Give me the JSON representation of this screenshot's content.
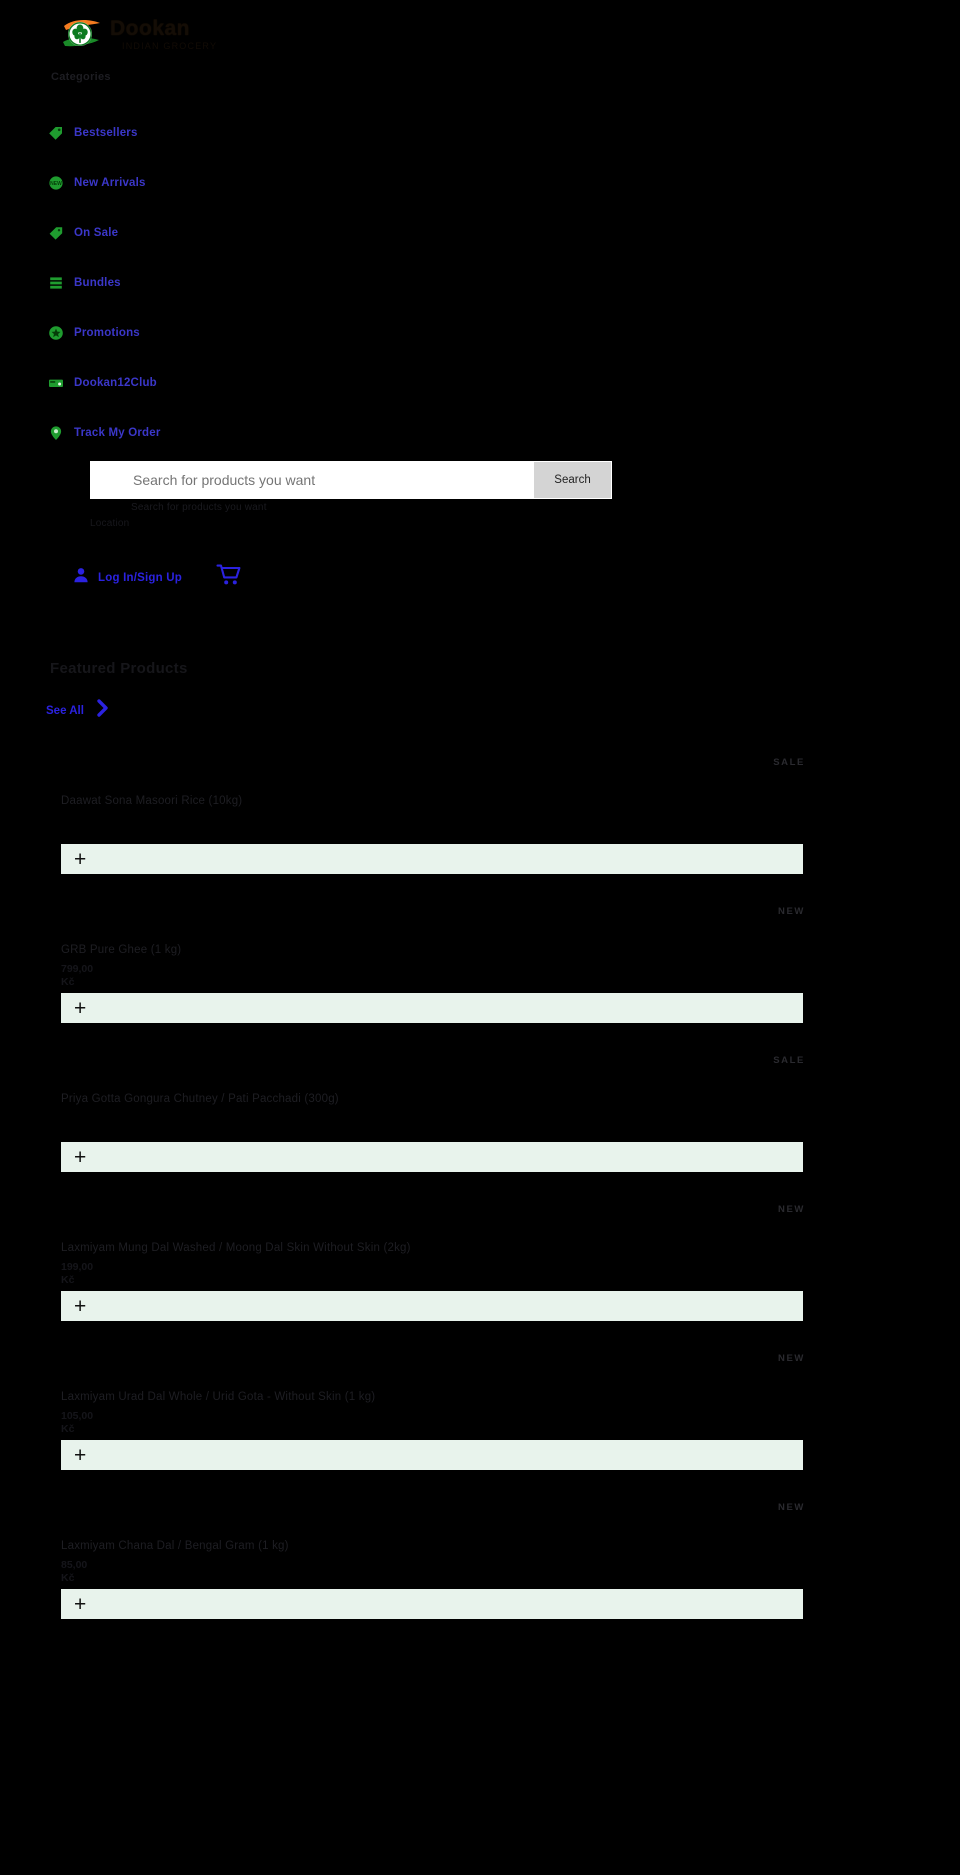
{
  "brand": {
    "name": "Dookan",
    "tagline": "INDIAN GROCERY",
    "logo_icon": "india-flag-tree-logo",
    "accent_green": "#1f9c2f",
    "accent_blue": "#2b22e0",
    "add_bar_bg": "#e8f3ec"
  },
  "sidebar": {
    "heading": "Categories",
    "items": [
      {
        "label": "Bestsellers",
        "icon": "tag-icon"
      },
      {
        "label": "New Arrivals",
        "icon": "new-badge-icon"
      },
      {
        "label": "On Sale",
        "icon": "sale-tag-icon"
      },
      {
        "label": "Bundles",
        "icon": "stack-icon"
      },
      {
        "label": "Promotions",
        "icon": "star-circle-icon"
      },
      {
        "label": "Dookan12Club",
        "icon": "membership-card-icon"
      },
      {
        "label": "Track My Order",
        "icon": "location-pin-icon"
      }
    ]
  },
  "search": {
    "placeholder": "Search for products you want",
    "ghost_text": "Search for products you want",
    "button_label": "Search",
    "icon": "search-icon"
  },
  "location": {
    "label": "Location",
    "icon": "location-pin-icon"
  },
  "account": {
    "login_label": "Log In/Sign Up",
    "user_icon": "user-icon",
    "cart_icon": "shopping-cart-icon"
  },
  "section": {
    "title": "Featured Products",
    "see_all_label": "See All",
    "chevron_icon": "chevron-right-icon"
  },
  "products": [
    {
      "badge": "SALE",
      "title": "Daawat Sona Masoori Rice (10kg)",
      "price": "",
      "currency": "",
      "add_label": "+"
    },
    {
      "badge": "NEW",
      "title": "GRB Pure Ghee (1 kg)",
      "price": "799,00",
      "currency": "Kč",
      "add_label": "+"
    },
    {
      "badge": "SALE",
      "title": "Priya Gotta Gongura Chutney / Pati Pacchadi (300g)",
      "price": "",
      "currency": "",
      "add_label": "+"
    },
    {
      "badge": "NEW",
      "title": "Laxmiyam Mung Dal Washed / Moong Dal Skin Without Skin (2kg)",
      "price": "199,00",
      "currency": "Kč",
      "add_label": "+"
    },
    {
      "badge": "NEW",
      "title": "Laxmiyam Urad Dal Whole / Urid Gota - Without Skin (1 kg)",
      "price": "105,00",
      "currency": "Kč",
      "add_label": "+"
    },
    {
      "badge": "NEW",
      "title": "Laxmiyam Chana Dal / Bengal Gram (1 kg)",
      "price": "85,00",
      "currency": "Kč",
      "add_label": "+"
    }
  ]
}
